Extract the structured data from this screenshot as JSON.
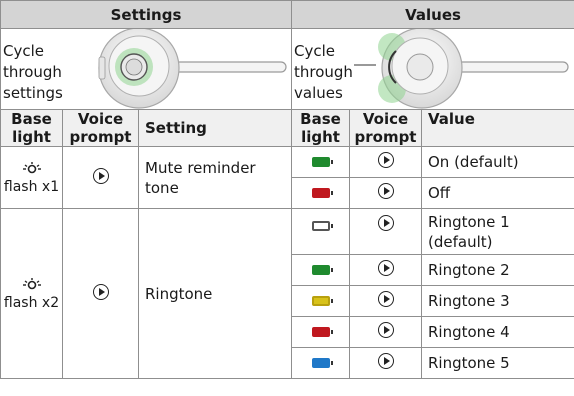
{
  "headers": {
    "settings": "Settings",
    "values": "Values"
  },
  "illustration": {
    "left_text": [
      "Cycle",
      "through",
      "settings"
    ],
    "right_text": [
      "Cycle",
      "through",
      "values"
    ]
  },
  "columns_left": {
    "base_light": [
      "Base",
      "light"
    ],
    "voice_prompt": [
      "Voice",
      "prompt"
    ],
    "setting": "Setting"
  },
  "columns_right": {
    "base_light": [
      "Base",
      "light"
    ],
    "voice_prompt": [
      "Voice",
      "prompt"
    ],
    "value": "Value"
  },
  "settings": [
    {
      "flash": "flash x1",
      "name": [
        "Mute reminder",
        "tone"
      ],
      "values": [
        {
          "label": [
            "On (default)"
          ],
          "battery_color": "#1f8a2e"
        },
        {
          "label": [
            "Off"
          ],
          "battery_color": "#c0181f"
        }
      ]
    },
    {
      "flash": "flash x2",
      "name": [
        "Ringtone"
      ],
      "values": [
        {
          "label": [
            "Ringtone 1",
            "(default)"
          ],
          "battery_color": "#ffffff"
        },
        {
          "label": [
            "Ringtone 2"
          ],
          "battery_color": "#1f8a2e"
        },
        {
          "label": [
            "Ringtone 3"
          ],
          "battery_color": "#d8c21a"
        },
        {
          "label": [
            "Ringtone 4"
          ],
          "battery_color": "#c0181f"
        },
        {
          "label": [
            "Ringtone 5"
          ],
          "battery_color": "#1f78c8"
        }
      ]
    }
  ],
  "icons": {
    "flash": "base-light-flash-icon",
    "play": "play-circle-icon",
    "battery": "battery-light-icon"
  }
}
